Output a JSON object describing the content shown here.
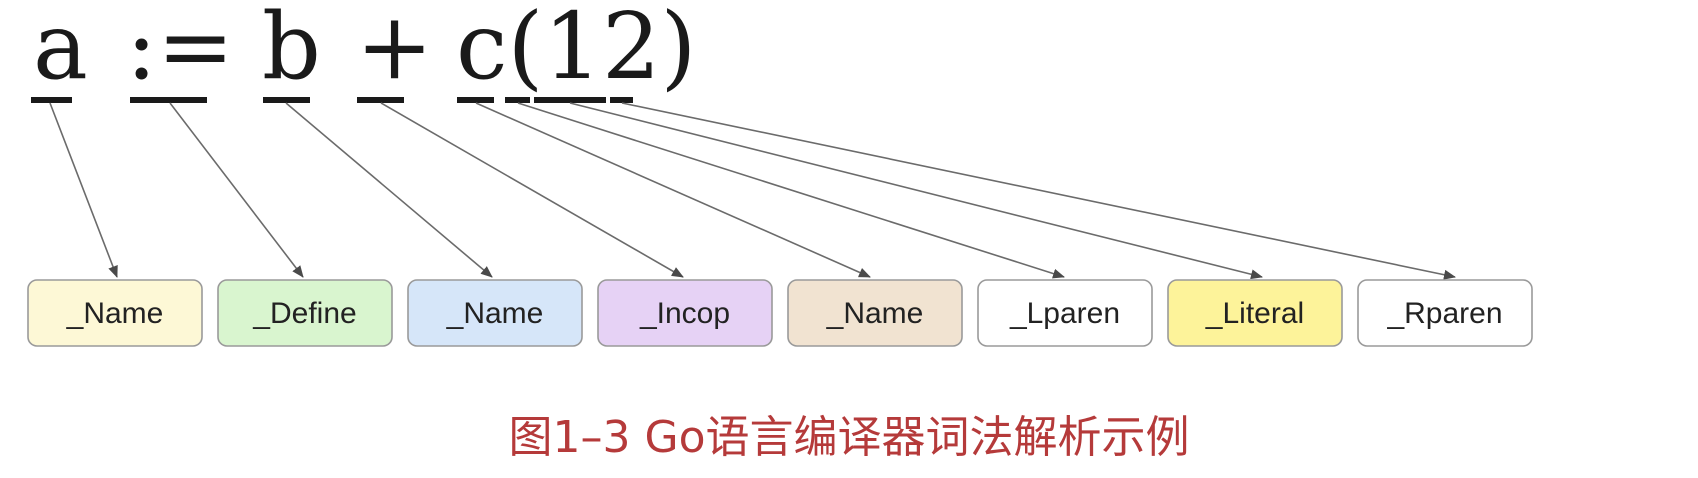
{
  "source": {
    "tokens": [
      {
        "text": "a"
      },
      {
        "text": ":="
      },
      {
        "text": "b"
      },
      {
        "text": "+"
      },
      {
        "text": "c(12)"
      }
    ]
  },
  "token_types": [
    {
      "label": "_Name",
      "fill": "#fdf8d6",
      "source_part": "a"
    },
    {
      "label": "_Define",
      "fill": "#d9f5cf",
      "source_part": ":="
    },
    {
      "label": "_Name",
      "fill": "#d6e6f9",
      "source_part": "b"
    },
    {
      "label": "_Incop",
      "fill": "#e6d2f5",
      "source_part": "+"
    },
    {
      "label": "_Name",
      "fill": "#f1e3d1",
      "source_part": "c"
    },
    {
      "label": "_Lparen",
      "fill": "#ffffff",
      "source_part": "("
    },
    {
      "label": "_Literal",
      "fill": "#fdf39a",
      "source_part": "12"
    },
    {
      "label": "_Rparen",
      "fill": "#ffffff",
      "source_part": ")"
    }
  ],
  "caption": {
    "text": "图1–3 Go语言编译器词法解析示例",
    "color": "#b53a3a"
  },
  "colors": {
    "text": "#1a1a1a",
    "arrow": "#6b6b6b",
    "box_border": "#9a9a9a"
  }
}
